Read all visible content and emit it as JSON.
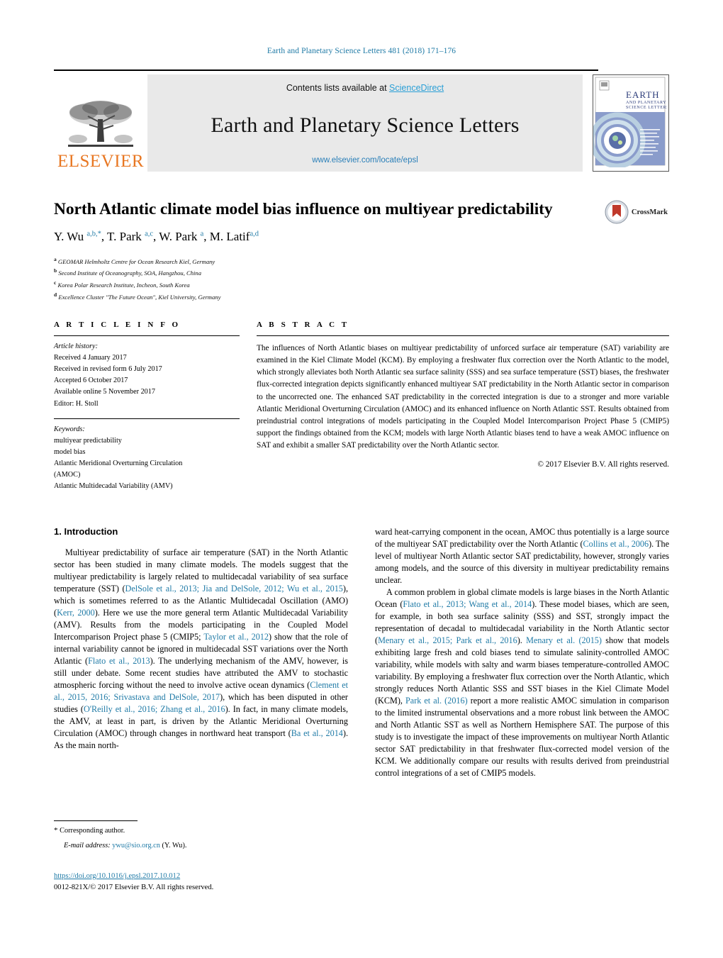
{
  "running_head": "Earth and Planetary Science Letters 481 (2018) 171–176",
  "masthead": {
    "contents_prefix": "Contents lists available at ",
    "sciencedirect": "ScienceDirect",
    "journal_title": "Earth and Planetary Science Letters",
    "journal_url": "www.elsevier.com/locate/epsl",
    "publisher": "ELSEVIER",
    "cover_title_main": "EARTH",
    "cover_title_sub": "AND PLANETARY",
    "cover_title_sub2": "SCIENCE LETTERS"
  },
  "article": {
    "title": "North Atlantic climate model bias influence on multiyear predictability",
    "crossmark_label": "CrossMark",
    "authors_html": "Y. Wu <sup>a,b,*</sup>, T. Park <sup>a,c</sup>, W. Park <sup>a</sup>, M. Latif<sup>a,d</sup>",
    "affiliations": [
      {
        "mark": "a",
        "text": "GEOMAR Helmholtz Centre for Ocean Research Kiel, Germany"
      },
      {
        "mark": "b",
        "text": "Second Institute of Oceanography, SOA, Hangzhou, China"
      },
      {
        "mark": "c",
        "text": "Korea Polar Research Institute, Incheon, South Korea"
      },
      {
        "mark": "d",
        "text": "Excellence Cluster \"The Future Ocean\", Kiel University, Germany"
      }
    ]
  },
  "article_info": {
    "heading": "A R T I C L E   I N F O",
    "history_label": "Article history:",
    "history": [
      "Received 4 January 2017",
      "Received in revised form 6 July 2017",
      "Accepted 6 October 2017",
      "Available online 5 November 2017",
      "Editor: H. Stoll"
    ],
    "keywords_label": "Keywords:",
    "keywords": [
      "multiyear predictability",
      "model bias",
      "Atlantic Meridional Overturning Circulation",
      "(AMOC)",
      "Atlantic Multidecadal Variability (AMV)"
    ]
  },
  "abstract": {
    "heading": "A B S T R A C T",
    "text": "The influences of North Atlantic biases on multiyear predictability of unforced surface air temperature (SAT) variability are examined in the Kiel Climate Model (KCM). By employing a freshwater flux correction over the North Atlantic to the model, which strongly alleviates both North Atlantic sea surface salinity (SSS) and sea surface temperature (SST) biases, the freshwater flux-corrected integration depicts significantly enhanced multiyear SAT predictability in the North Atlantic sector in comparison to the uncorrected one. The enhanced SAT predictability in the corrected integration is due to a stronger and more variable Atlantic Meridional Overturning Circulation (AMOC) and its enhanced influence on North Atlantic SST. Results obtained from preindustrial control integrations of models participating in the Coupled Model Intercomparison Project Phase 5 (CMIP5) support the findings obtained from the KCM; models with large North Atlantic biases tend to have a weak AMOC influence on SAT and exhibit a smaller SAT predictability over the North Atlantic sector.",
    "copyright": "© 2017 Elsevier B.V. All rights reserved."
  },
  "sections": {
    "intro_heading": "1. Introduction"
  },
  "intro_left": {
    "p1_html": "Multiyear predictability of surface air temperature (SAT) in the North Atlantic sector has been studied in many climate models. The models suggest that the multiyear predictability is largely related to multidecadal variability of sea surface temperature (SST) (<span class=\"ref\">DelSole et al., 2013; Jia and DelSole, 2012; Wu et al., 2015</span>), which is sometimes referred to as the Atlantic Multidecadal Oscillation (AMO) (<span class=\"ref\">Kerr, 2000</span>). Here we use the more general term Atlantic Multidecadal Variability (AMV). Results from the models participating in the Coupled Model Intercomparison Project phase 5 (CMIP5; <span class=\"ref\">Taylor et al., 2012</span>) show that the role of internal variability cannot be ignored in multidecadal SST variations over the North Atlantic (<span class=\"ref\">Flato et al., 2013</span>). The underlying mechanism of the AMV, however, is still under debate. Some recent studies have attributed the AMV to stochastic atmospheric forcing without the need to involve active ocean dynamics (<span class=\"ref\">Clement et al., 2015, 2016; Srivastava and DelSole, 2017</span>), which has been disputed in other studies (<span class=\"ref\">O'Reilly et al., 2016; Zhang et al., 2016</span>). In fact, in many climate models, the AMV, at least in part, is driven by the Atlantic Meridional Overturning Circulation (AMOC) through changes in northward heat transport (<span class=\"ref\">Ba et al., 2014</span>). As the main north-"
  },
  "intro_right": {
    "p1_html": "ward heat-carrying component in the ocean, AMOC thus potentially is a large source of the multiyear SAT predictability over the North Atlantic (<span class=\"ref\">Collins et al., 2006</span>). The level of multiyear North Atlantic sector SAT predictability, however, strongly varies among models, and the source of this diversity in multiyear predictability remains unclear.",
    "p2_html": "A common problem in global climate models is large biases in the North Atlantic Ocean (<span class=\"ref\">Flato et al., 2013; Wang et al., 2014</span>). These model biases, which are seen, for example, in both sea surface salinity (SSS) and SST, strongly impact the representation of decadal to multidecadal variability in the North Atlantic sector (<span class=\"ref\">Menary et al., 2015; Park et al., 2016</span>). <span class=\"ref\">Menary et al. (2015)</span> show that models exhibiting large fresh and cold biases tend to simulate salinity-controlled AMOC variability, while models with salty and warm biases temperature-controlled AMOC variability. By employing a freshwater flux correction over the North Atlantic, which strongly reduces North Atlantic SSS and SST biases in the Kiel Climate Model (KCM), <span class=\"ref\">Park et al. (2016)</span> report a more realistic AMOC simulation in comparison to the limited instrumental observations and a more robust link between the AMOC and North Atlantic SST as well as Northern Hemisphere SAT. The purpose of this study is to investigate the impact of these improvements on multiyear North Atlantic sector SAT predictability in that freshwater flux-corrected model version of the KCM. We additionally compare our results with results derived from preindustrial control integrations of a set of CMIP5 models."
  },
  "footer": {
    "star": "*",
    "corresponding": "Corresponding author.",
    "email_label": "E-mail address:",
    "email": "ywu@sio.org.cn",
    "email_suffix": "(Y. Wu).",
    "doi": "https://doi.org/10.1016/j.epsl.2017.10.012",
    "issn_line": "0012-821X/© 2017 Elsevier B.V. All rights reserved."
  },
  "colors": {
    "link": "#1f7aa6",
    "elsevier_orange": "#E87722",
    "sciencedirect": "#2a9fd6"
  }
}
